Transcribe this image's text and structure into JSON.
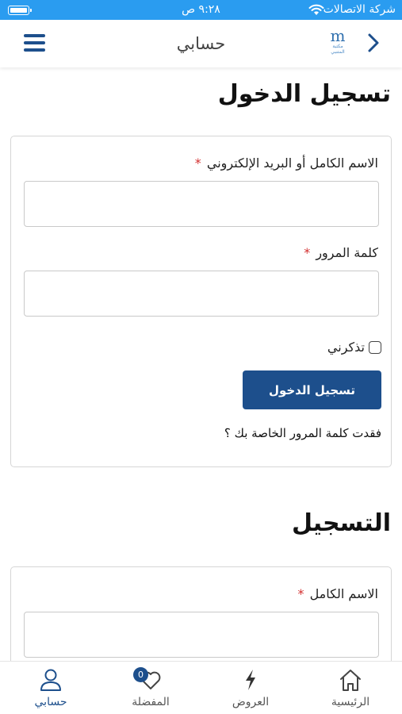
{
  "status_bar": {
    "carrier": "شركة الاتصالات",
    "time": "٩:٢٨ ص"
  },
  "header": {
    "title": "حسابي",
    "logo_mark": "m",
    "logo_text": "مكتبة المتنبي"
  },
  "login": {
    "title": "تسجيل الدخول",
    "username_label": "الاسم الكامل أو البريد الإلكتروني",
    "username_value": "",
    "password_label": "كلمة المرور",
    "password_value": "",
    "required_mark": "*",
    "remember_label": "تذكرني",
    "remember_checked": false,
    "submit_label": "تسجيل الدخول",
    "forgot_link": "فقدت كلمة المرور الخاصة بك ؟"
  },
  "register": {
    "title": "التسجيل",
    "fullname_label": "الاسم الكامل",
    "fullname_value": "",
    "required_mark": "*"
  },
  "tabs": [
    {
      "label": "حسابي",
      "icon": "user-icon",
      "active": true
    },
    {
      "label": "المفضلة",
      "icon": "heart-icon",
      "badge": "0"
    },
    {
      "label": "العروض",
      "icon": "lightning-icon"
    },
    {
      "label": "الرئيسية",
      "icon": "home-icon"
    }
  ],
  "colors": {
    "status_bar": "#2a9cf0",
    "primary": "#1d4f8c",
    "required": "#d32f2f"
  }
}
